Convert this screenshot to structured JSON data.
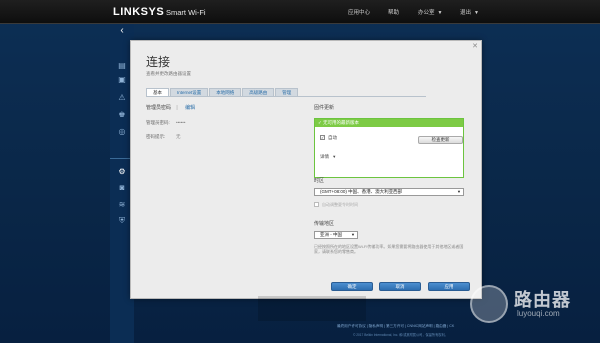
{
  "header": {
    "brand": "LINKSYS",
    "product": "Smart Wi-Fi",
    "nav": [
      "应用中心",
      "帮助",
      "办公室",
      "退出"
    ]
  },
  "sidebar": {
    "back_icon": "chevron-left-icon",
    "items": [
      {
        "icon": "network-map-icon",
        "glyph": "▤"
      },
      {
        "icon": "device-list-icon",
        "glyph": "▣"
      },
      {
        "icon": "alert-icon",
        "glyph": "⚠"
      },
      {
        "icon": "parental-controls-icon",
        "glyph": "♚"
      },
      {
        "icon": "speed-test-icon",
        "glyph": "◎"
      },
      {
        "icon": "connectivity-gear-icon",
        "glyph": "⚙"
      },
      {
        "icon": "troubleshooting-icon",
        "glyph": "◙"
      },
      {
        "icon": "wireless-icon",
        "glyph": "≋"
      },
      {
        "icon": "security-shield-icon",
        "glyph": "⛨"
      }
    ]
  },
  "panel": {
    "title": "连接",
    "subtitle": "查看并更改路由器设置",
    "tabs": [
      "基本",
      "Internet设置",
      "本地网络",
      "高级路由",
      "管理"
    ],
    "left": {
      "header": "管理员密码",
      "edit": "编辑",
      "fields": [
        {
          "label": "管理员密码:",
          "value": "••••••"
        },
        {
          "label": "密码提示:",
          "value": "无"
        }
      ]
    },
    "firmware": {
      "header": "固件更新",
      "banner": "✓ 无可用的最新版本",
      "auto_label": "自动",
      "check_button": "检查更新",
      "details": "详情"
    },
    "timezone": {
      "header": "时区",
      "value": "(GMT+08:00) 中国、香港、澳大利亚西部",
      "dst_label": "自动调整夏令时时间"
    },
    "region": {
      "header": "传输地区",
      "value": "亚洲 - 中国",
      "note": "已经按照所在的地区设置Wi-Fi传输功率。如果您需要将路由器使用于其他地区或者国家，请联系您的零售商。"
    },
    "buttons": {
      "ok": "确定",
      "cancel": "取消",
      "apply": "应用"
    }
  },
  "footer": {
    "links": "最终用户许可协议 | 隐私声明 | 第三方许可 | CNNIC网站声明 | 路由器 | CK",
    "copyright": "© 2017 Belkin International, Inc. 和/或其附属公司，保留所有权利。"
  },
  "watermark": {
    "text": "路由器",
    "sub": "luyouqi.com"
  }
}
